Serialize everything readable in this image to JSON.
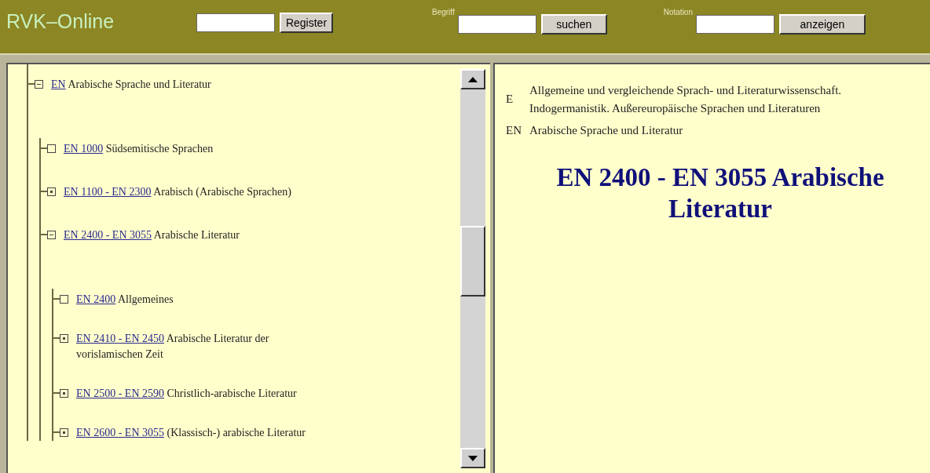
{
  "header": {
    "title": "RVK–Online",
    "register": {
      "button": "Register"
    },
    "search": {
      "label": "Begriff",
      "button": "suchen"
    },
    "notation": {
      "label": "Notation",
      "button": "anzeigen"
    }
  },
  "tree": [
    {
      "code": "EN",
      "label": "Arabische Sprache und Literatur",
      "kind": "node",
      "expanded": true,
      "children": [
        {
          "code": "EN 1000",
          "label": "Südsemitische Sprachen",
          "kind": "leaf"
        },
        {
          "code": "EN 1100 - EN 2300",
          "label": "Arabisch (Arabische Sprachen)",
          "kind": "node",
          "expanded": false
        },
        {
          "code": "EN 2400 - EN 3055",
          "label": "Arabische Literatur",
          "kind": "node",
          "expanded": true,
          "children": [
            {
              "code": "EN 2400",
              "label": "Allgemeines",
              "kind": "leaf"
            },
            {
              "code": "EN 2410 - EN 2450",
              "label": "Arabische Literatur der vorislamischen Zeit",
              "kind": "node",
              "expanded": false
            },
            {
              "code": "EN 2500 - EN 2590",
              "label": "Christlich-arabische Literatur",
              "kind": "node",
              "expanded": false
            },
            {
              "code": "EN 2600 - EN 3055",
              "label": "(Klassisch-) arabische Literatur",
              "kind": "node",
              "expanded": false
            }
          ]
        }
      ]
    }
  ],
  "detail": {
    "breadcrumb": [
      {
        "code": "E",
        "label": "Allgemeine und vergleichende Sprach- und Literaturwissenschaft. Indogermanistik. Außereuropäische Sprachen und Literaturen"
      },
      {
        "code": "EN",
        "label": "Arabische Sprache und Literatur"
      }
    ],
    "heading": "EN 2400 - EN 3055 Arabische Literatur"
  }
}
